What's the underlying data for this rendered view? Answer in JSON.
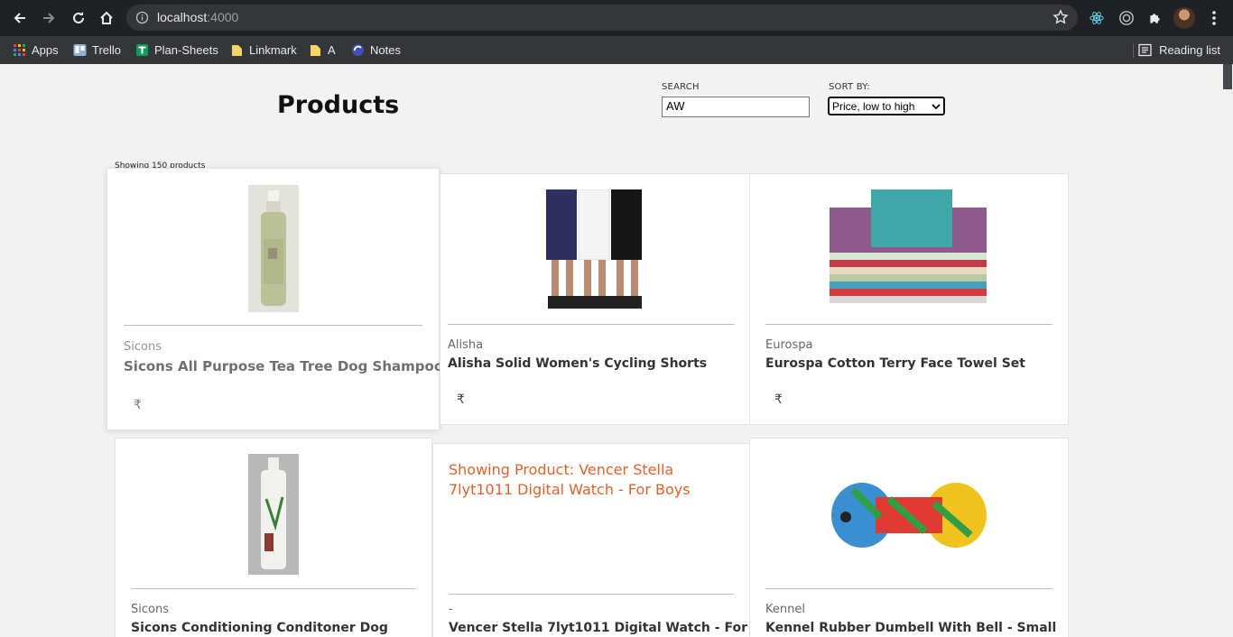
{
  "browser": {
    "url_host": "localhost",
    "url_port": ":4000",
    "bookmarks": [
      "Apps",
      "Trello",
      "Plan-Sheets",
      "Linkmark",
      "A",
      "Notes"
    ],
    "reading_list": "Reading list"
  },
  "header": {
    "title": "Products",
    "search_label": "SEARCH",
    "search_value": "AW",
    "sort_label": "SORT BY:",
    "sort_value": "Price, low to high"
  },
  "results": {
    "count_text": "Showing 150 products"
  },
  "products": [
    {
      "brand": "Sicons",
      "name": "Sicons All Purpose Tea Tree Dog Shampoo",
      "price": "₹"
    },
    {
      "brand": "Alisha",
      "name": "Alisha Solid Women's Cycling Shorts",
      "price": "₹"
    },
    {
      "brand": "Eurospa",
      "name": "Eurospa Cotton Terry Face Towel Set",
      "price": "₹"
    },
    {
      "brand": "Sicons",
      "name": "Sicons Conditioning Conditoner Dog",
      "price": ""
    },
    {
      "brand": "-",
      "name": "Vencer Stella 7lyt1011 Digital Watch - For",
      "price": "",
      "image_alt": "Showing Product: Vencer Stella 7lyt1011 Digital Watch - For Boys"
    },
    {
      "brand": "Kennel",
      "name": "Kennel Rubber Dumbell With Bell - Small",
      "price": ""
    }
  ]
}
